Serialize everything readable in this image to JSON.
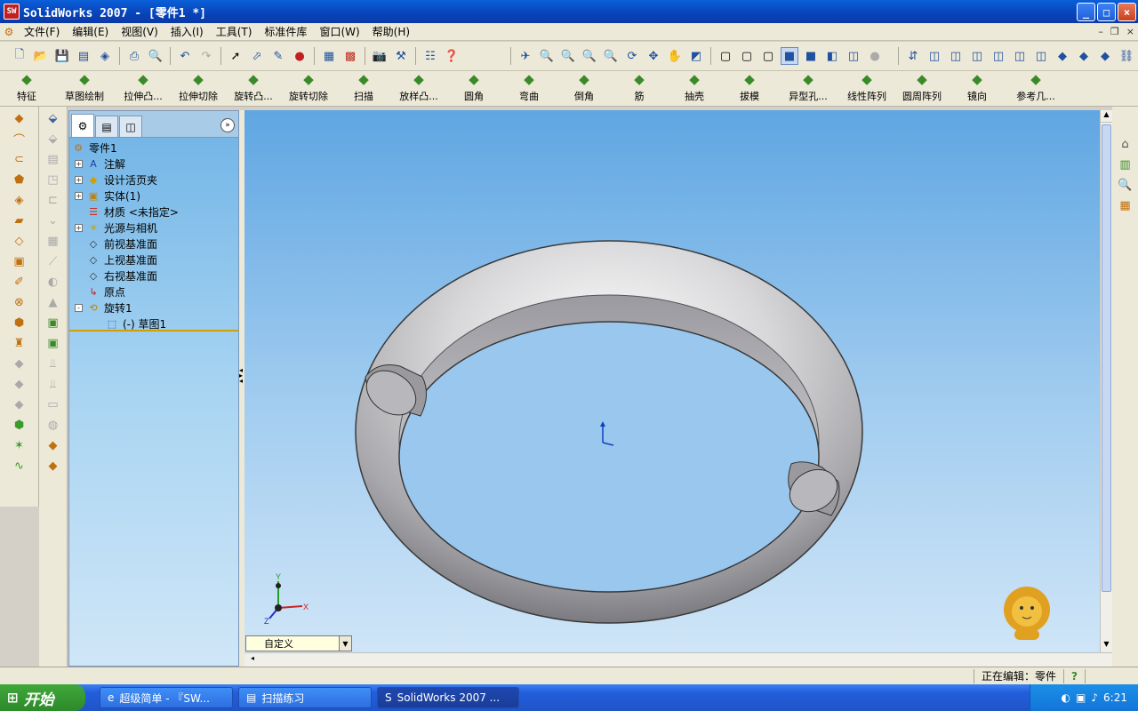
{
  "window": {
    "title": "SolidWorks 2007 - [零件1 *]",
    "app_icon": "SW"
  },
  "menu": [
    "文件(F)",
    "编辑(E)",
    "视图(V)",
    "插入(I)",
    "工具(T)",
    "标准件库",
    "窗口(W)",
    "帮助(H)"
  ],
  "command_manager": [
    {
      "label": "特征",
      "icon": "features-icon"
    },
    {
      "label": "草图绘制",
      "icon": "sketch-icon"
    },
    {
      "label": "拉伸凸...",
      "icon": "extrude-boss-icon"
    },
    {
      "label": "拉伸切除",
      "icon": "extrude-cut-icon"
    },
    {
      "label": "旋转凸...",
      "icon": "revolve-boss-icon"
    },
    {
      "label": "旋转切除",
      "icon": "revolve-cut-icon"
    },
    {
      "label": "扫描",
      "icon": "sweep-icon"
    },
    {
      "label": "放样凸...",
      "icon": "loft-icon"
    },
    {
      "label": "圆角",
      "icon": "fillet-icon"
    },
    {
      "label": "弯曲",
      "icon": "flex-icon"
    },
    {
      "label": "倒角",
      "icon": "chamfer-icon"
    },
    {
      "label": "筋",
      "icon": "rib-icon"
    },
    {
      "label": "抽壳",
      "icon": "shell-icon"
    },
    {
      "label": "拔模",
      "icon": "draft-icon"
    },
    {
      "label": "异型孔...",
      "icon": "hole-wizard-icon"
    },
    {
      "label": "线性阵列",
      "icon": "linear-pattern-icon"
    },
    {
      "label": "圆周阵列",
      "icon": "circular-pattern-icon"
    },
    {
      "label": "镜向",
      "icon": "mirror-icon"
    },
    {
      "label": "参考几...",
      "icon": "reference-geometry-icon"
    }
  ],
  "tree": {
    "root": "零件1",
    "items": [
      {
        "label": "注解",
        "expander": "+",
        "icon": "annotation-icon"
      },
      {
        "label": "设计活页夹",
        "expander": "+",
        "icon": "design-binder-icon"
      },
      {
        "label": "实体(1)",
        "expander": "+",
        "icon": "solid-bodies-icon"
      },
      {
        "label": "材质 <未指定>",
        "expander": "",
        "icon": "material-icon"
      },
      {
        "label": "光源与相机",
        "expander": "+",
        "icon": "lights-cameras-icon"
      },
      {
        "label": "前视基准面",
        "expander": "",
        "icon": "plane-icon"
      },
      {
        "label": "上视基准面",
        "expander": "",
        "icon": "plane-icon"
      },
      {
        "label": "右视基准面",
        "expander": "",
        "icon": "plane-icon"
      },
      {
        "label": "原点",
        "expander": "",
        "icon": "origin-icon"
      },
      {
        "label": "旋转1",
        "expander": "-",
        "icon": "revolve-feature-icon"
      }
    ],
    "sub_item": "(-) 草图1"
  },
  "view_orientation": "自定义",
  "status": {
    "editing": "正在编辑：零件"
  },
  "taskbar": {
    "start": "开始",
    "tasks": [
      {
        "label": "超级简单 - 『SW...",
        "icon": "browser-icon"
      },
      {
        "label": "扫描练习",
        "icon": "folder-icon"
      },
      {
        "label": "SolidWorks 2007 ...",
        "icon": "solidworks-icon"
      }
    ],
    "clock": "6:21"
  },
  "triad": {
    "x": "X",
    "y": "Y",
    "z": "Z"
  }
}
